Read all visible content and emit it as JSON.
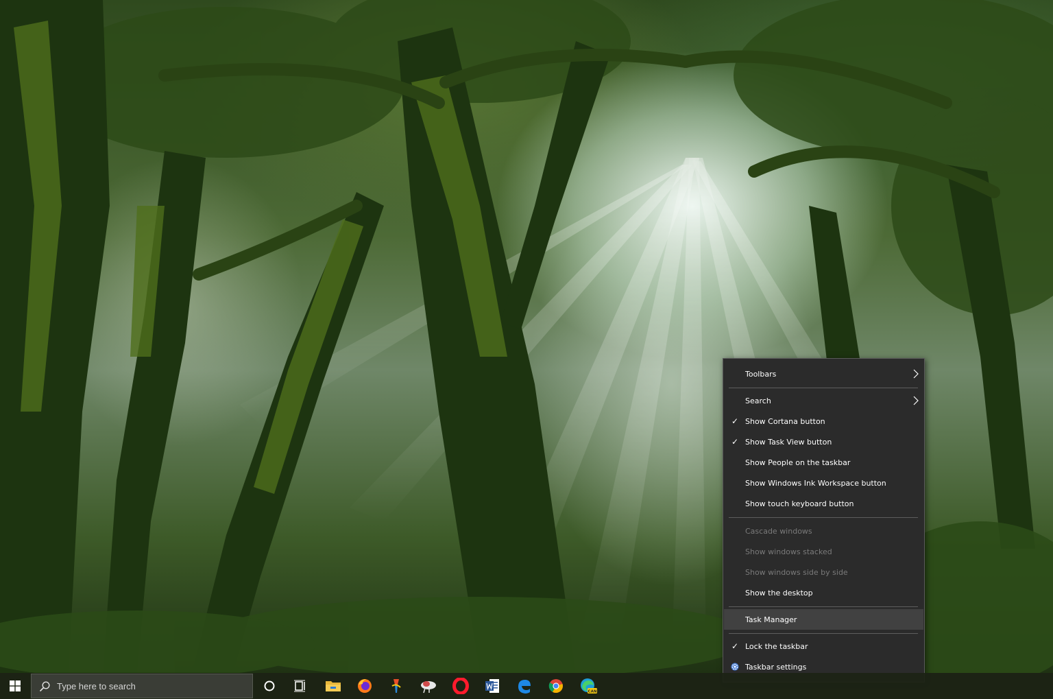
{
  "context_menu": {
    "items": [
      {
        "label": "Toolbars",
        "checked": false,
        "submenu": true,
        "disabled": false
      },
      {
        "label": "Search",
        "checked": false,
        "submenu": true,
        "disabled": false
      },
      {
        "label": "Show Cortana button",
        "checked": true,
        "submenu": false,
        "disabled": false
      },
      {
        "label": "Show Task View button",
        "checked": true,
        "submenu": false,
        "disabled": false
      },
      {
        "label": "Show People on the taskbar",
        "checked": false,
        "submenu": false,
        "disabled": false
      },
      {
        "label": "Show Windows Ink Workspace button",
        "checked": false,
        "submenu": false,
        "disabled": false
      },
      {
        "label": "Show touch keyboard button",
        "checked": false,
        "submenu": false,
        "disabled": false
      },
      {
        "label": "Cascade windows",
        "checked": false,
        "submenu": false,
        "disabled": true
      },
      {
        "label": "Show windows stacked",
        "checked": false,
        "submenu": false,
        "disabled": true
      },
      {
        "label": "Show windows side by side",
        "checked": false,
        "submenu": false,
        "disabled": true
      },
      {
        "label": "Show the desktop",
        "checked": false,
        "submenu": false,
        "disabled": false
      },
      {
        "label": "Task Manager",
        "checked": false,
        "submenu": false,
        "disabled": false,
        "highlighted": true
      },
      {
        "label": "Lock the taskbar",
        "checked": true,
        "submenu": false,
        "disabled": false
      },
      {
        "label": "Taskbar settings",
        "checked": false,
        "submenu": false,
        "disabled": false,
        "icon": "gear-icon"
      }
    ],
    "check_glyph": "✓"
  },
  "taskbar": {
    "search_placeholder": "Type here to search",
    "pinned_apps": [
      "cortana-icon",
      "task-view-icon",
      "file-explorer-icon",
      "firefox-icon",
      "paint-3d-icon",
      "cloud-app-icon",
      "opera-icon",
      "word-icon",
      "edge-legacy-icon",
      "chrome-icon",
      "edge-canary-icon"
    ],
    "edge_canary_badge": "CAN"
  }
}
